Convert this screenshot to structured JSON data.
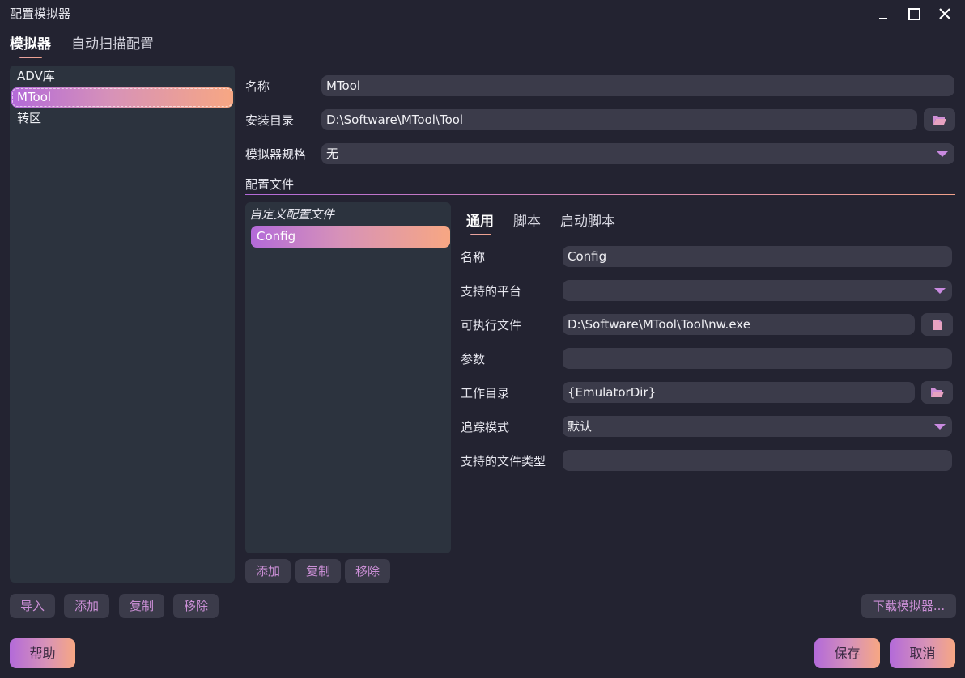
{
  "window": {
    "title": "配置模拟器"
  },
  "top_tabs": [
    "模拟器",
    "自动扫描配置"
  ],
  "emulator_list": [
    "ADV库",
    "MTool",
    "转区"
  ],
  "left_buttons": [
    "导入",
    "添加",
    "复制",
    "移除"
  ],
  "form": {
    "name_label": "名称",
    "name_value": "MTool",
    "install_dir_label": "安装目录",
    "install_dir_value": "D:\\Software\\MTool\\Tool",
    "spec_label": "模拟器规格",
    "spec_value": "无"
  },
  "config_section_title": "配置文件",
  "config_list": {
    "header": "自定义配置文件",
    "items": [
      "Config"
    ]
  },
  "config_buttons": [
    "添加",
    "复制",
    "移除"
  ],
  "sub_tabs": [
    "通用",
    "脚本",
    "启动脚本"
  ],
  "general": {
    "name_label": "名称",
    "name_value": "Config",
    "platform_label": "支持的平台",
    "platform_value": "",
    "exe_label": "可执行文件",
    "exe_value": "D:\\Software\\MTool\\Tool\\nw.exe",
    "args_label": "参数",
    "args_value": "",
    "workdir_label": "工作目录",
    "workdir_value": "{EmulatorDir}",
    "trace_label": "追踪模式",
    "trace_value": "默认",
    "filetypes_label": "支持的文件类型",
    "filetypes_value": ""
  },
  "download_button": "下载模拟器...",
  "footer": {
    "help": "帮助",
    "save": "保存",
    "cancel": "取消"
  },
  "colors": {
    "accent_start": "#b36ad9",
    "accent_end": "#f7a783",
    "background": "#232331",
    "panel": "#2c333e",
    "field": "#3b3b4a"
  }
}
